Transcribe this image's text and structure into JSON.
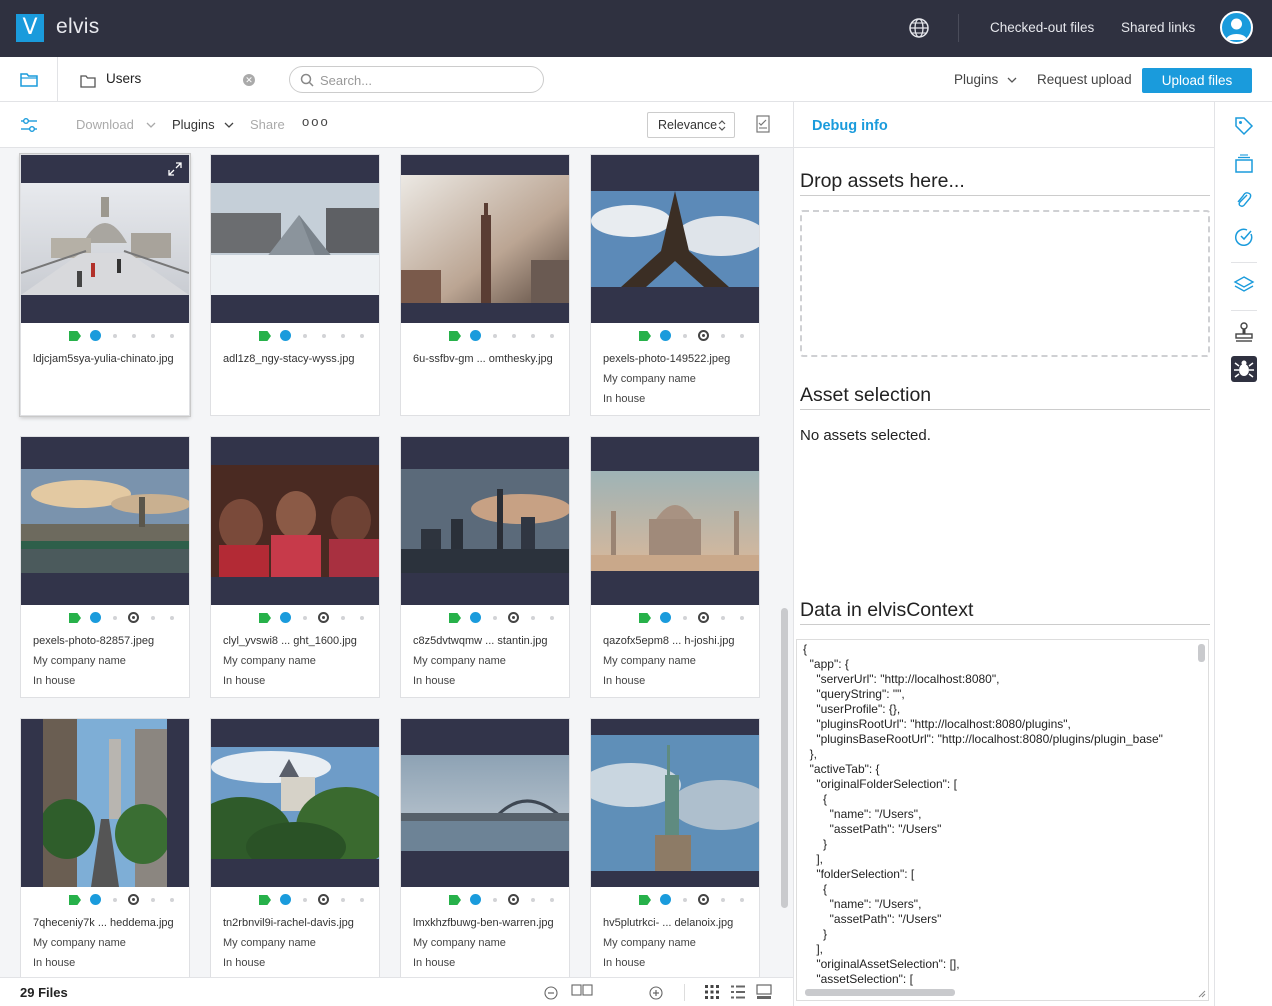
{
  "header": {
    "app_name": "elvis",
    "logo_letter": "V",
    "checked_out": "Checked-out files",
    "shared_links": "Shared links"
  },
  "tabbar": {
    "tab_label": "Users",
    "search_placeholder": "Search...",
    "plugins": "Plugins",
    "request_upload": "Request upload",
    "upload_files": "Upload files"
  },
  "toolbar": {
    "download": "Download",
    "plugins": "Plugins",
    "share": "Share",
    "more": "ooo",
    "sort": "Relevance"
  },
  "assets": [
    {
      "name": "ldjcjam5sya-yulia-chinato.jpg",
      "company": "",
      "usage": "",
      "copyright": false
    },
    {
      "name": "adl1z8_ngy-stacy-wyss.jpg",
      "company": "",
      "usage": "",
      "copyright": false
    },
    {
      "name": "6u-ssfbv-gm ... omthesky.jpg",
      "company": "",
      "usage": "",
      "copyright": false
    },
    {
      "name": "pexels-photo-149522.jpeg",
      "company": "My company name",
      "usage": "In house",
      "copyright": true
    },
    {
      "name": "pexels-photo-82857.jpeg",
      "company": "My company name",
      "usage": "In house",
      "copyright": true
    },
    {
      "name": "clyl_yvswi8 ... ght_1600.jpg",
      "company": "My company name",
      "usage": "In house",
      "copyright": true
    },
    {
      "name": "c8z5dvtwqmw ... stantin.jpg",
      "company": "My company name",
      "usage": "In house",
      "copyright": true
    },
    {
      "name": "qazofx5epm8 ... h-joshi.jpg",
      "company": "My company name",
      "usage": "In house",
      "copyright": true
    },
    {
      "name": "7qheceniy7k ... heddema.jpg",
      "company": "My company name",
      "usage": "In house",
      "copyright": true
    },
    {
      "name": "tn2rbnvil9i-rachel-davis.jpg",
      "company": "My company name",
      "usage": "In house",
      "copyright": true
    },
    {
      "name": "lmxkhzfbuwg-ben-warren.jpg",
      "company": "My company name",
      "usage": "In house",
      "copyright": true
    },
    {
      "name": "hv5plutrkci- ... delanoix.jpg",
      "company": "My company name",
      "usage": "In house",
      "copyright": true
    }
  ],
  "statusbar": {
    "files_count": "29 Files"
  },
  "panel": {
    "title": "Debug info",
    "drop_heading": "Drop assets here...",
    "selection_heading": "Asset selection",
    "no_assets": "No assets selected.",
    "context_heading": "Data in elvisContext",
    "context_json": "{\n  \"app\": {\n    \"serverUrl\": \"http://localhost:8080\",\n    \"queryString\": \"\",\n    \"userProfile\": {},\n    \"pluginsRootUrl\": \"http://localhost:8080/plugins\",\n    \"pluginsBaseRootUrl\": \"http://localhost:8080/plugins/plugin_base\"\n  },\n  \"activeTab\": {\n    \"originalFolderSelection\": [\n      {\n        \"name\": \"/Users\",\n        \"assetPath\": \"/Users\"\n      }\n    ],\n    \"folderSelection\": [\n      {\n        \"name\": \"/Users\",\n        \"assetPath\": \"/Users\"\n      }\n    ],\n    \"originalAssetSelection\": [],\n    \"assetSelection\": ["
  },
  "colors": {
    "topbar": "#2f3140",
    "accent": "#1a9bdc",
    "tag_green": "#27b14a"
  }
}
